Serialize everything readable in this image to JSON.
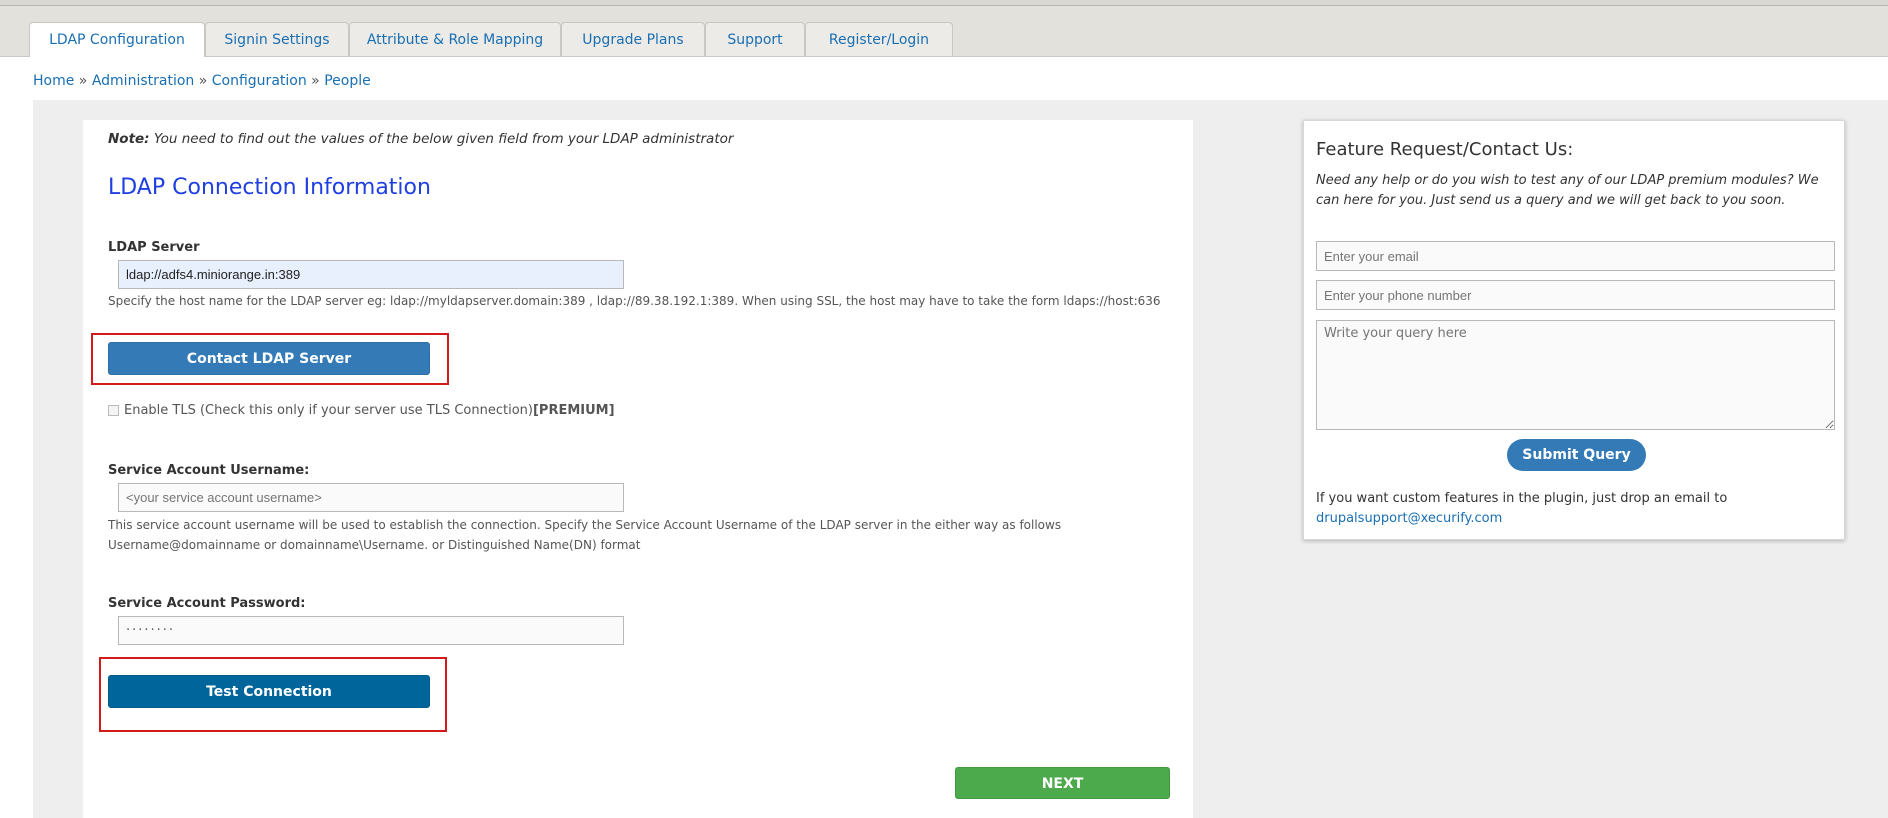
{
  "tabs": [
    {
      "label": "LDAP Configuration"
    },
    {
      "label": "Signin Settings"
    },
    {
      "label": "Attribute & Role Mapping"
    },
    {
      "label": "Upgrade Plans"
    },
    {
      "label": "Support"
    },
    {
      "label": "Register/Login"
    }
  ],
  "breadcrumb": {
    "home": "Home",
    "sep": "»",
    "administration": "Administration",
    "configuration": "Configuration",
    "people": "People"
  },
  "main": {
    "note_prefix": "Note:",
    "note_text": " You need to find out the values of the below given field from your LDAP administrator",
    "heading": "LDAP Connection Information",
    "ldap_server": {
      "label": "LDAP Server",
      "value": "ldap://adfs4.miniorange.in:389",
      "help": "Specify the host name for the LDAP server eg: ldap://myldapserver.domain:389 , ldap://89.38.192.1:389. When using SSL, the host may have to take the form ldaps://host:636"
    },
    "contact_button": "Contact LDAP Server",
    "tls": {
      "label": "Enable TLS (Check this only if your server use TLS Connection)",
      "premium": "[PREMIUM]"
    },
    "service_username": {
      "label": "Service Account Username:",
      "placeholder": "<your service account username>",
      "help_line1": "This service account username will be used to establish the connection. Specify the Service Account Username of the LDAP server in the either way as follows",
      "help_line2": "Username@domainname or domainname\\Username. or Distinguished Name(DN) format"
    },
    "service_password": {
      "label": "Service Account Password:",
      "value": "········"
    },
    "test_button": "Test Connection",
    "next_button": "NEXT"
  },
  "sidebar": {
    "title": "Feature Request/Contact Us:",
    "description": "Need any help or do you wish to test any of our LDAP premium modules? We can here for you. Just send us a query and we will get back to you soon.",
    "email_placeholder": "Enter your email",
    "phone_placeholder": "Enter your phone number",
    "query_placeholder": "Write your query here",
    "submit_button": "Submit Query",
    "custom_text": "If you want custom features in the plugin, just drop an email to",
    "support_email": "drupalsupport@xecurify.com"
  },
  "colors": {
    "accent_blue": "#337ab7",
    "test_blue": "#00659a",
    "next_green": "#4ca94c",
    "link": "#1a6fb3",
    "heading": "#1f3fe0",
    "highlight_red": "#d11a1a"
  }
}
